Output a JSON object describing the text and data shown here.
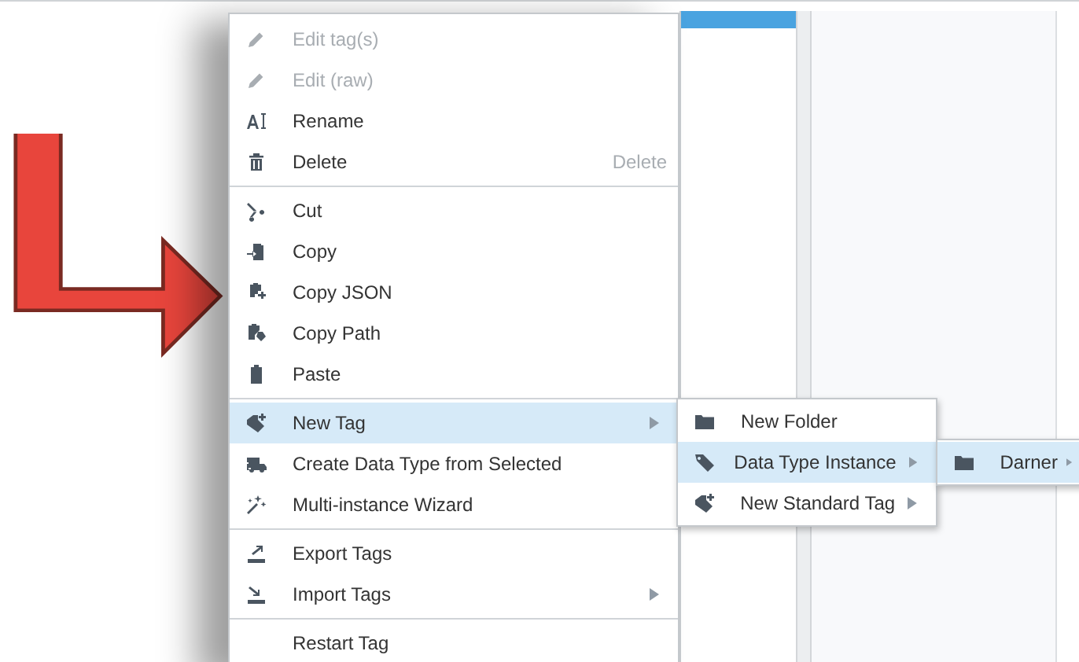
{
  "context_menu": {
    "sections": [
      [
        {
          "label": "Edit tag(s)",
          "disabled": true,
          "selected": false,
          "submenu": false
        },
        {
          "label": "Edit (raw)",
          "disabled": true,
          "selected": false,
          "submenu": false
        },
        {
          "label": "Rename",
          "disabled": false,
          "selected": false,
          "submenu": false
        },
        {
          "label": "Delete",
          "disabled": false,
          "selected": false,
          "submenu": false,
          "shortcut": "Delete"
        }
      ],
      [
        {
          "label": "Cut",
          "disabled": false,
          "selected": false,
          "submenu": false
        },
        {
          "label": "Copy",
          "disabled": false,
          "selected": false,
          "submenu": false
        },
        {
          "label": "Copy JSON",
          "disabled": false,
          "selected": false,
          "submenu": false
        },
        {
          "label": "Copy Path",
          "disabled": false,
          "selected": false,
          "submenu": false
        },
        {
          "label": "Paste",
          "disabled": false,
          "selected": false,
          "submenu": false
        }
      ],
      [
        {
          "label": "New Tag",
          "disabled": false,
          "selected": true,
          "submenu": true
        },
        {
          "label": "Create Data Type from Selected",
          "disabled": false,
          "selected": false,
          "submenu": false
        },
        {
          "label": "Multi-instance Wizard",
          "disabled": false,
          "selected": false,
          "submenu": false
        }
      ],
      [
        {
          "label": "Export Tags",
          "disabled": false,
          "selected": false,
          "submenu": false
        },
        {
          "label": "Import Tags",
          "disabled": false,
          "selected": false,
          "submenu": true
        }
      ],
      [
        {
          "label": "Restart Tag",
          "disabled": false,
          "selected": false,
          "submenu": false
        }
      ]
    ]
  },
  "new_tag_submenu": {
    "items": [
      {
        "label": "New Folder",
        "selected": false,
        "submenu": false
      },
      {
        "label": "Data Type Instance",
        "selected": true,
        "submenu": true
      },
      {
        "label": "New Standard Tag",
        "selected": false,
        "submenu": true
      }
    ]
  },
  "data_type_submenu": {
    "items": [
      {
        "label": "Darner",
        "selected": true,
        "submenu": true
      }
    ]
  }
}
